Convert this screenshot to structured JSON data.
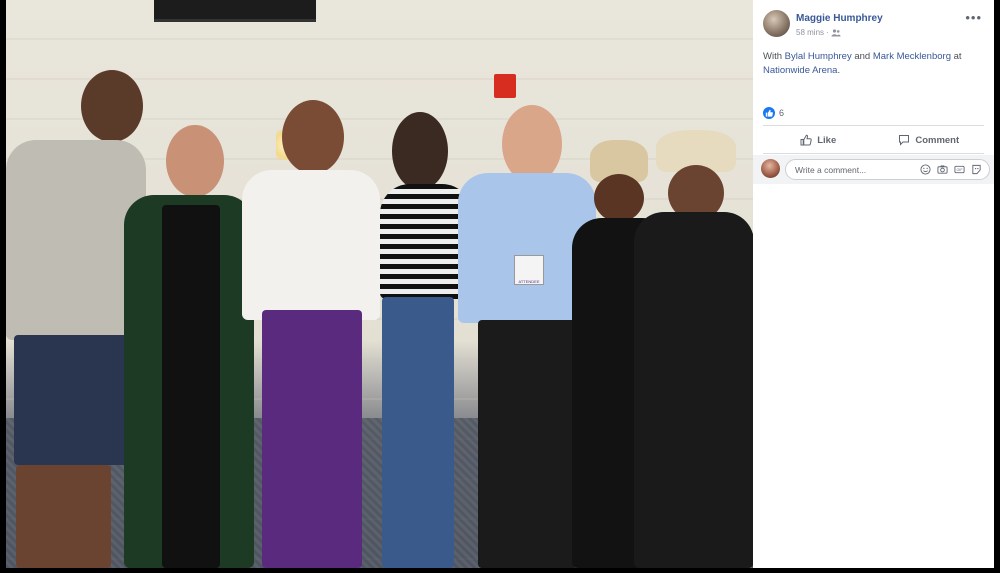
{
  "post": {
    "author": "Maggie Humphrey",
    "timestamp": "58 mins",
    "privacy_icon": "friends-icon",
    "text_prefix": "With ",
    "tag1": "Bylal Humphrey",
    "text_and": " and ",
    "tag2": "Mark Mecklenborg",
    "text_at": " at ",
    "location": "Nationwide Arena",
    "text_end": ".",
    "reaction_count": "6",
    "like_label": "Like",
    "comment_label": "Comment",
    "comment_placeholder": "Write a comment..."
  },
  "photo": {
    "badge_text": "ATTENDEE"
  },
  "colors": {
    "link": "#385898",
    "like_blue": "#1877f2",
    "muted": "#606770"
  }
}
